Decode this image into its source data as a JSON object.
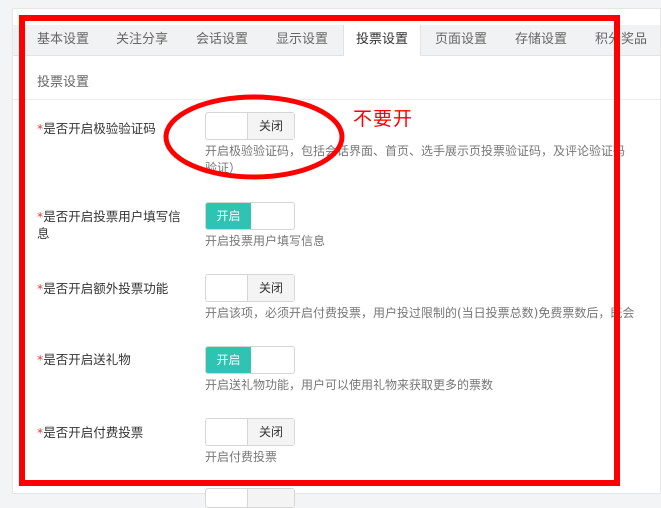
{
  "tabs": [
    {
      "label": "基本设置"
    },
    {
      "label": "关注分享"
    },
    {
      "label": "会话设置"
    },
    {
      "label": "显示设置"
    },
    {
      "label": "投票设置",
      "active": true
    },
    {
      "label": "页面设置"
    },
    {
      "label": "存储设置"
    },
    {
      "label": "积分奖品"
    }
  ],
  "section_title": "投票设置",
  "settings": [
    {
      "label": "是否开启极验验证码",
      "state": "关闭",
      "on": false,
      "help_line1": "开启极验验证码，包括会话界面、首页、选手展示页投票验证码，及评论验证码",
      "help_line2": "验证）"
    },
    {
      "label": "是否开启投票用户填写信息",
      "state": "开启",
      "on": true,
      "help_line1": "开启投票用户填写信息"
    },
    {
      "label": "是否开启额外投票功能",
      "state": "关闭",
      "on": false,
      "help_line1": "开启该项，必须开启付费投票，用户投过限制的(当日投票总数)免费票数后，既会"
    },
    {
      "label": "是否开启送礼物",
      "state": "开启",
      "on": true,
      "help_line1": "开启送礼物功能，用户可以使用礼物来获取更多的票数"
    },
    {
      "label": "是否开启付费投票",
      "state": "关闭",
      "on": false,
      "help_line1": "开启付费投票"
    }
  ],
  "annotation": {
    "text": "不要开",
    "color": "#ff0000"
  },
  "colors": {
    "switch_on": "#2fc3b3",
    "required_star": "#e23a3a",
    "markup_red": "#ff0000"
  }
}
